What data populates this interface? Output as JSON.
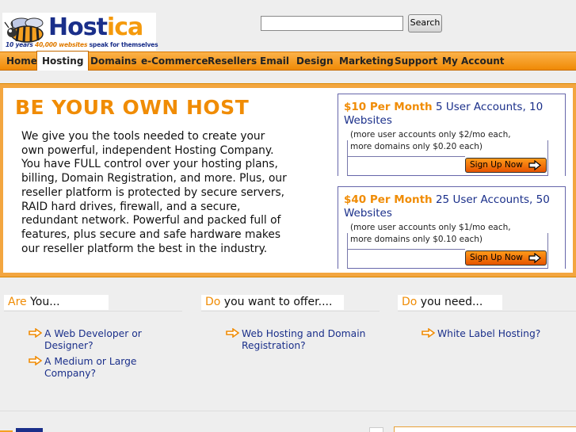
{
  "logo": {
    "name_part1": "Host",
    "name_part2": "ica",
    "tag_num": "10 years",
    "tag_num2": "40,000",
    "tag_sites": "websites",
    "tag_rest": "speak for themselves"
  },
  "search": {
    "value": "",
    "button_label": "Search"
  },
  "nav": {
    "items": [
      {
        "label": "Home"
      },
      {
        "label": "Hosting"
      },
      {
        "label": "Domains"
      },
      {
        "label": "e-Commerce"
      },
      {
        "label": "Resellers"
      },
      {
        "label": "Email"
      },
      {
        "label": "Design"
      },
      {
        "label": "Marketing"
      },
      {
        "label": "Support"
      },
      {
        "label": "My Account"
      }
    ],
    "active": "Hosting"
  },
  "hero": {
    "title": "BE YOUR OWN HOST",
    "body": "We give you the tools needed to create your own powerful, independent Hosting Company. You have FULL control over your hosting plans, billing, Domain Registration, and more. Plus, our reseller platform is protected by secure servers, RAID hard drives, firewall, and a secure, redundant network. Powerful and packed full of features, plus secure and safe hardware makes our reseller platform the best in the industry."
  },
  "plans": [
    {
      "price": "$10 Per Month",
      "desc": "5 User Accounts, 10 Websites",
      "note1": "(more user accounts only $2/mo each,",
      "note2": "more domains only $0.20 each)",
      "button": "Sign Up Now"
    },
    {
      "price": "$40 Per Month",
      "desc": "25 User Accounts, 50 Websites",
      "note1": "(more user accounts only $1/mo each,",
      "note2": "more domains only $0.10 each)",
      "button": "Sign Up Now"
    }
  ],
  "columns": [
    {
      "hl": "Are",
      "rest": " You...",
      "links": [
        "A Web Developer or Designer?",
        "A Medium or Large Company?"
      ]
    },
    {
      "hl": "Do",
      "rest": " you want to offer....",
      "links": [
        "Web Hosting and Domain Registration?"
      ]
    },
    {
      "hl": "Do",
      "rest": " you need...",
      "links": [
        "White Label Hosting?"
      ]
    }
  ],
  "colors": {
    "accent": "#f08c05",
    "link": "#1a2f8a",
    "nav_bg": "#f5a032"
  }
}
